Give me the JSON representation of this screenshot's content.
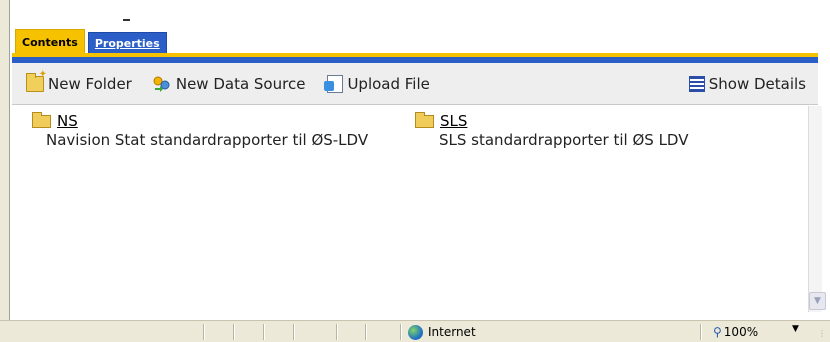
{
  "tabs": {
    "contents_label": "Contents",
    "properties_label": "Properties"
  },
  "toolbar": {
    "new_folder_label": "New Folder",
    "new_data_source_label": "New Data Source",
    "upload_file_label": "Upload File",
    "show_details_label": "Show Details"
  },
  "items": [
    {
      "name": "NS",
      "description": "Navision Stat standardrapporter til ØS-LDV",
      "icon": "folder-icon"
    },
    {
      "name": "SLS",
      "description": "SLS standardrapporter til ØS LDV",
      "icon": "folder-icon"
    }
  ],
  "statusbar": {
    "zone_label": "Internet",
    "zoom_label": "100%"
  },
  "colors": {
    "tab_active": "#f6c200",
    "tab_inactive": "#2b5fc7",
    "toolbar_bg": "#eeeeee"
  }
}
